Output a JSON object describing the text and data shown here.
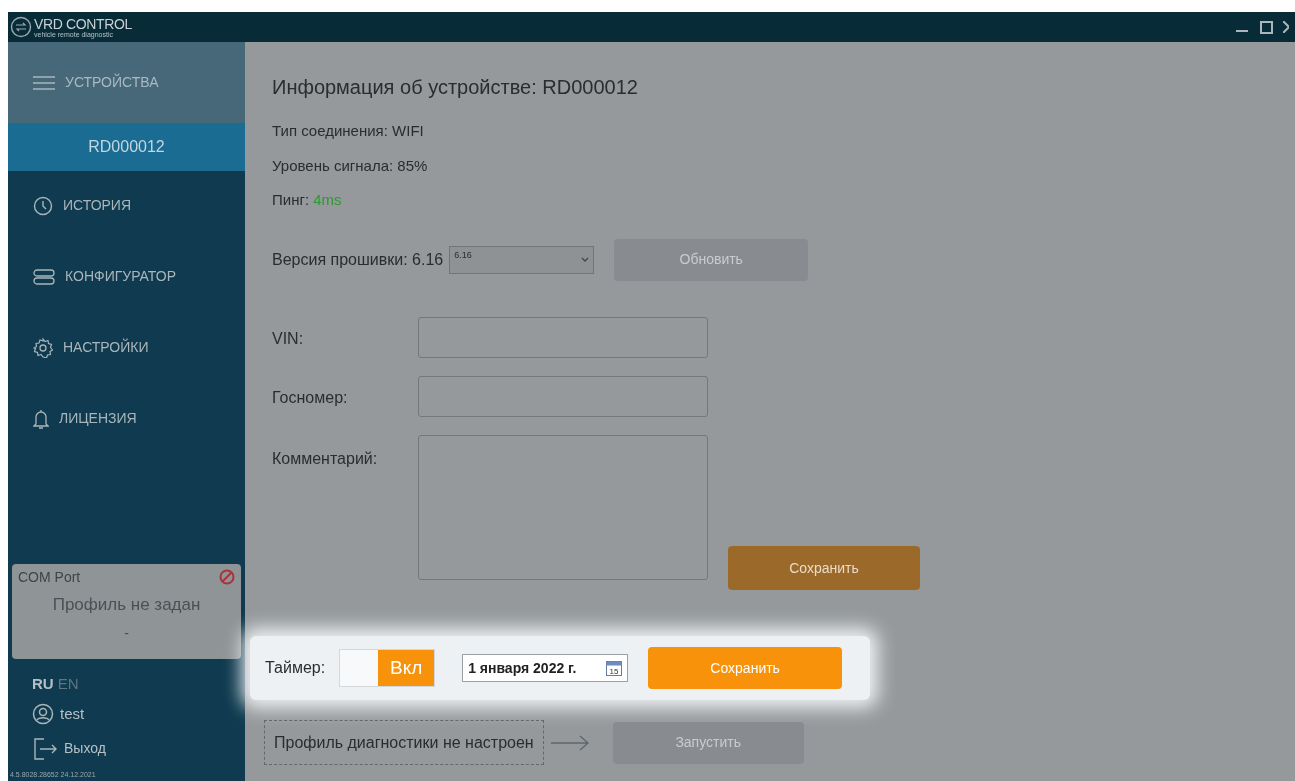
{
  "window": {
    "logo_title": "VRD CONTROL",
    "logo_subtitle": "vehicle remote diagnostic"
  },
  "sidebar": {
    "items": [
      {
        "label": "УСТРОЙСТВА",
        "kind": "section",
        "selected": false
      },
      {
        "label": "RD000012",
        "kind": "device",
        "selected": true
      },
      {
        "label": "ИСТОРИЯ",
        "kind": "link",
        "selected": false
      },
      {
        "label": "КОНФИГУРАТОР",
        "kind": "link",
        "selected": false
      },
      {
        "label": "НАСТРОЙКИ",
        "kind": "link",
        "selected": false
      },
      {
        "label": "ЛИЦЕНЗИЯ",
        "kind": "link",
        "selected": false
      }
    ],
    "port_card": {
      "title": "COM Port",
      "profile": "Профиль не задан",
      "value": "-"
    },
    "languages": [
      {
        "label": "RU",
        "selected": true
      },
      {
        "label": "EN",
        "selected": false
      }
    ],
    "user": "test",
    "logout": "Выход",
    "version": "4.5.8028.28652 24.12.2021"
  },
  "main": {
    "title": "Информация об устройстве: RD000012",
    "info": [
      {
        "label": "Тип соединения: ",
        "value": "WIFI",
        "kind": "plain"
      },
      {
        "label": "Уровень сигнала: ",
        "value": "85%",
        "kind": "plain"
      },
      {
        "label": "Пинг: ",
        "value": "4ms",
        "kind": "good"
      }
    ],
    "firmware": {
      "label": "Версия прошивки: 6.16",
      "selected_version": "6.16",
      "button": {
        "label": "Обновить",
        "disabled": true
      }
    },
    "fields": [
      {
        "label": "VIN:",
        "kind": "line"
      },
      {
        "label": "Госномер:",
        "kind": "line"
      },
      {
        "label": "Комментарий:",
        "kind": "area"
      }
    ],
    "save_button": {
      "label": "Сохранить",
      "disabled": false
    },
    "timer": {
      "label": "Таймер:",
      "toggle_label": "Вкл",
      "on": true,
      "date": "1 января 2022 г.",
      "calendar_day": "15",
      "save_label": "Сохранить"
    },
    "profile": {
      "text": "Профиль диагностики не настроен",
      "button": {
        "label": "Запустить",
        "disabled": true
      }
    }
  }
}
